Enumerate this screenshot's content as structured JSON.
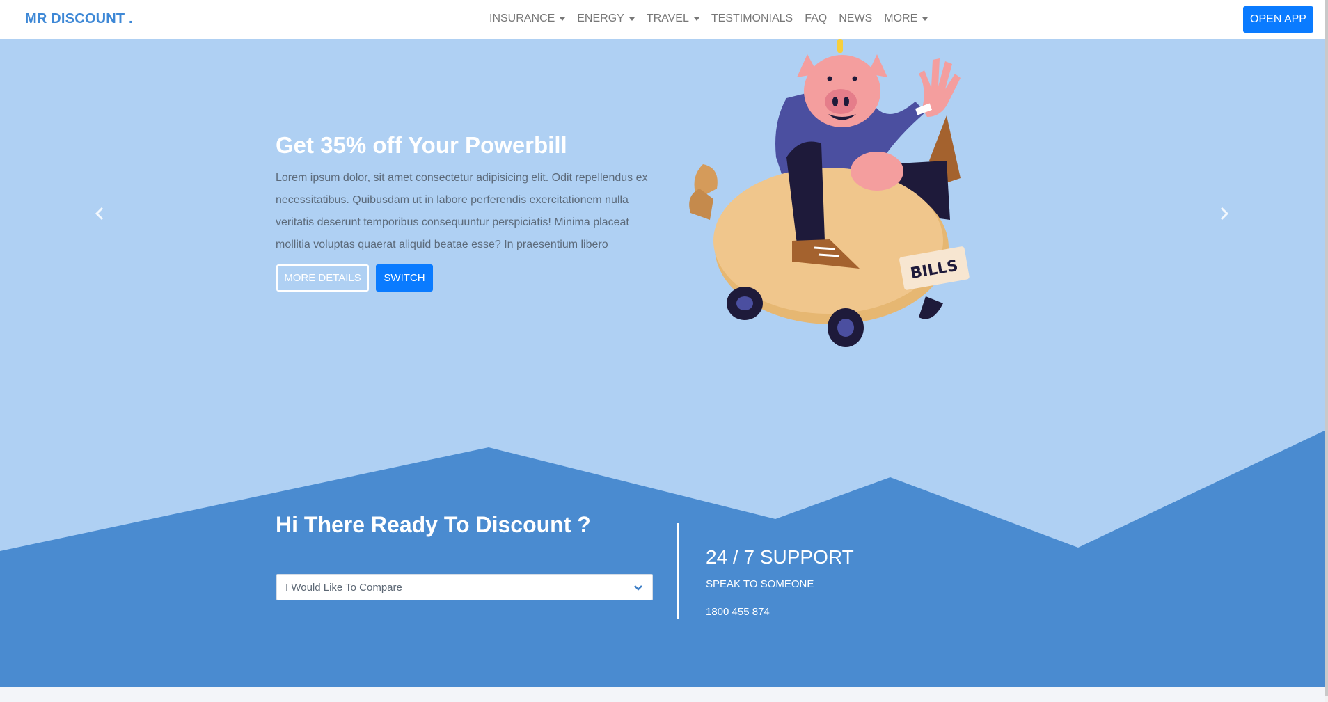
{
  "brand": "MR DISCOUNT .",
  "nav": {
    "items": [
      {
        "label": "INSURANCE",
        "dropdown": true
      },
      {
        "label": "ENERGY",
        "dropdown": true
      },
      {
        "label": "TRAVEL",
        "dropdown": true
      },
      {
        "label": "TESTIMONIALS",
        "dropdown": false
      },
      {
        "label": "FAQ",
        "dropdown": false
      },
      {
        "label": "NEWS",
        "dropdown": false
      },
      {
        "label": "MORE",
        "dropdown": true
      }
    ],
    "open_app": "OPEN APP"
  },
  "hero": {
    "title": "Get 35% off Your Powerbill",
    "text": "Lorem ipsum dolor, sit amet consectetur adipisicing elit. Odit repellendus ex necessitatibus. Quibusdam ut in labore perferendis exercitationem nulla veritatis deserunt temporibus consequuntur perspiciatis! Minima placeat mollitia voluptas quaerat aliquid beatae esse? In praesentium libero",
    "more_details": "MORE DETAILS",
    "switch": "SWITCH",
    "illustration_label": "BILLS",
    "prev_icon": "chevron-left-icon",
    "next_icon": "chevron-right-icon"
  },
  "cta": {
    "title": "Hi There Ready To Discount ?",
    "select_value": "I Would Like To Compare",
    "support_title": "24 / 7 SUPPORT",
    "support_sub": "SPEAK TO SOMEONE",
    "support_phone": "1800 455 874"
  },
  "colors": {
    "brand": "#3e88d6",
    "hero_bg": "#afd0f3",
    "mountain": "#4a8bd0",
    "primary_button": "#0a7bff"
  }
}
